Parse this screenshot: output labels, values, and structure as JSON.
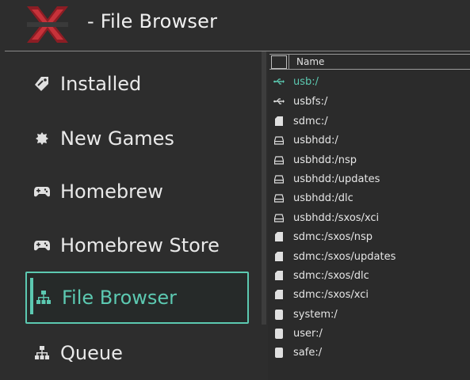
{
  "header": {
    "title": "- File Browser"
  },
  "sidebar": {
    "items": [
      {
        "label": "Installed",
        "icon": "tag-icon"
      },
      {
        "label": "New Games",
        "icon": "badge-icon"
      },
      {
        "label": "Homebrew",
        "icon": "gamepad-icon"
      },
      {
        "label": "Homebrew Store",
        "icon": "gamepad-icon"
      },
      {
        "label": "File Browser",
        "icon": "sitemap-icon",
        "selected": true
      },
      {
        "label": "Queue",
        "icon": "sitemap-icon"
      }
    ]
  },
  "files": {
    "column_name": "Name",
    "rows": [
      {
        "name": "usb:/",
        "icon": "usb-icon",
        "active": true
      },
      {
        "name": "usbfs:/",
        "icon": "usb-icon"
      },
      {
        "name": "sdmc:/",
        "icon": "sd-card-icon"
      },
      {
        "name": "usbhdd:/",
        "icon": "hard-drive-icon"
      },
      {
        "name": "usbhdd:/nsp",
        "icon": "hard-drive-icon"
      },
      {
        "name": "usbhdd:/updates",
        "icon": "hard-drive-icon"
      },
      {
        "name": "usbhdd:/dlc",
        "icon": "hard-drive-icon"
      },
      {
        "name": "usbhdd:/sxos/xci",
        "icon": "hard-drive-icon"
      },
      {
        "name": "sdmc:/sxos/nsp",
        "icon": "sd-card-icon"
      },
      {
        "name": "sdmc:/sxos/updates",
        "icon": "sd-card-icon"
      },
      {
        "name": "sdmc:/sxos/dlc",
        "icon": "sd-card-icon"
      },
      {
        "name": "sdmc:/sxos/xci",
        "icon": "sd-card-icon"
      },
      {
        "name": "system:/",
        "icon": "storage-icon"
      },
      {
        "name": "user:/",
        "icon": "storage-icon"
      },
      {
        "name": "safe:/",
        "icon": "storage-icon"
      }
    ]
  },
  "colors": {
    "accent": "#5cc9b1",
    "background": "#2d2d2d",
    "logo_red": "#b3262d"
  }
}
